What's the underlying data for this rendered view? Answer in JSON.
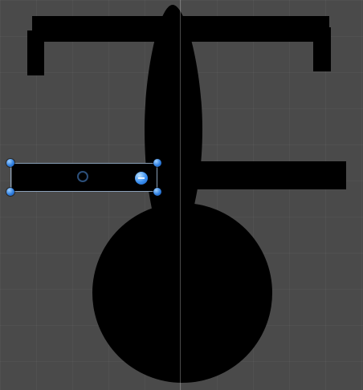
{
  "canvas": {
    "background_color": "#4a4a4a",
    "shape_color": "#000000",
    "handle_color": "#2f7fe0"
  },
  "selection": {
    "handles": [
      "top-left-handle",
      "top-right-handle",
      "bottom-left-handle",
      "bottom-right-handle"
    ]
  }
}
